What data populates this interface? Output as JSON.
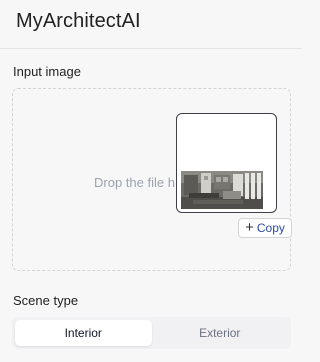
{
  "app": {
    "title": "MyArchitectAI"
  },
  "input_image": {
    "label": "Input image",
    "drop_text": "Drop the file h",
    "copy_button_label": "Copy",
    "copy_icon": "plus-icon",
    "preview_icon": "interior-render-thumbnail"
  },
  "scene_type": {
    "label": "Scene type",
    "options": [
      "Interior",
      "Exterior"
    ],
    "selected": "Interior"
  }
}
